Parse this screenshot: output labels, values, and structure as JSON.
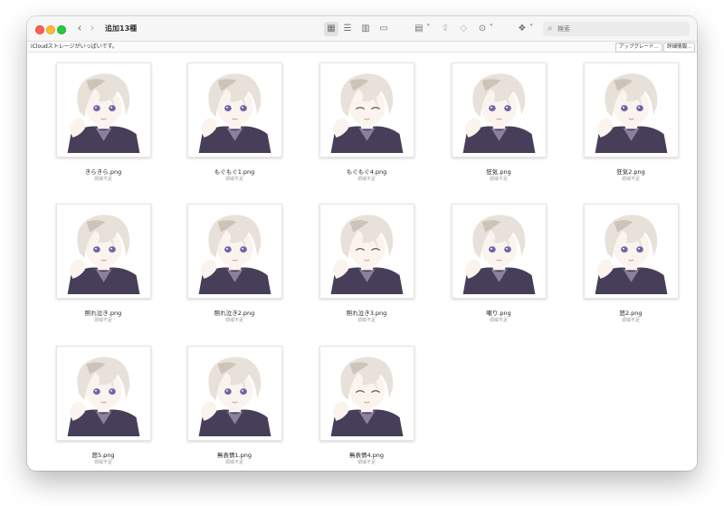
{
  "window": {
    "title": "追加13種"
  },
  "toolbar": {
    "back_glyph": "‹",
    "forward_glyph": "›",
    "view_icon_grid": "▦",
    "view_list": "☰",
    "view_columns": "▥",
    "view_gallery": "▭",
    "group_icon": "▤ ˅",
    "share_icon": "⇪",
    "tag_icon": "◇",
    "more_icon": "⊙ ˅",
    "dropbox_icon": "❖ ˅",
    "search_icon": "⌕",
    "search_placeholder": "検索"
  },
  "infobar": {
    "message": "iCloudストレージがいっぱいです。",
    "upgrade_label": "アップグレード...",
    "details_label": "詳細情報..."
  },
  "colors": {
    "hair": "#e8e1d9",
    "hair_shade": "#cdc3b8",
    "skin": "#fbf3ee",
    "eye": "#6e66a8",
    "jacket": "#473f59",
    "jacket_light": "#8c809f"
  },
  "files": [
    {
      "name": "きらきら.png",
      "status": "領域不足",
      "expression": "open"
    },
    {
      "name": "もぐもぐ1.png",
      "status": "領域不足",
      "expression": "open"
    },
    {
      "name": "もぐもぐ4.png",
      "status": "領域不足",
      "expression": "closed"
    },
    {
      "name": "狂気.png",
      "status": "領域不足",
      "expression": "open"
    },
    {
      "name": "狂気2.png",
      "status": "領域不足",
      "expression": "open"
    },
    {
      "name": "照れ泣き.png",
      "status": "領域不足",
      "expression": "open"
    },
    {
      "name": "照れ泣き2.png",
      "status": "領域不足",
      "expression": "open"
    },
    {
      "name": "照れ泣き3.png",
      "status": "領域不足",
      "expression": "closed"
    },
    {
      "name": "嘲り.png",
      "status": "領域不足",
      "expression": "open"
    },
    {
      "name": "怒2.png",
      "status": "領域不足",
      "expression": "open"
    },
    {
      "name": "怒5.png",
      "status": "領域不足",
      "expression": "open"
    },
    {
      "name": "無表情1.png",
      "status": "領域不足",
      "expression": "open"
    },
    {
      "name": "無表情4.png",
      "status": "領域不足",
      "expression": "closed"
    }
  ]
}
